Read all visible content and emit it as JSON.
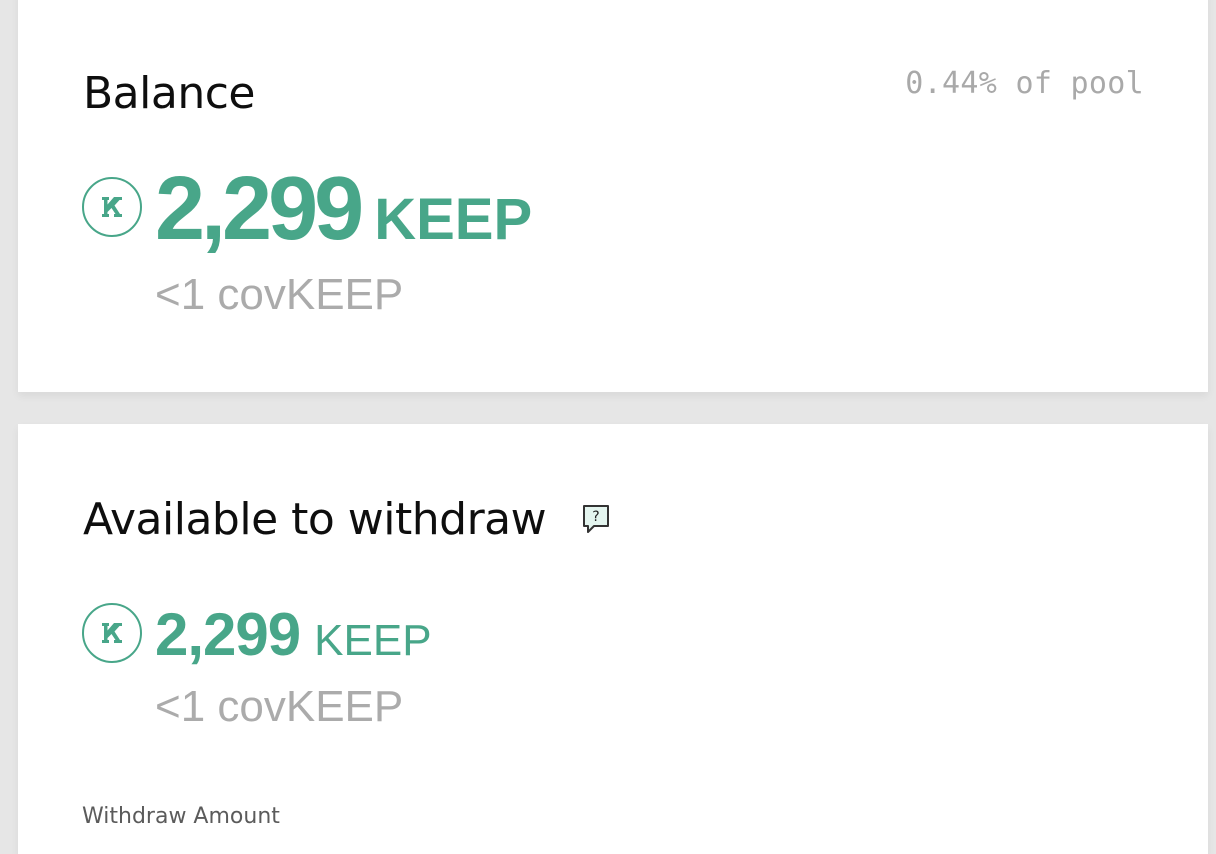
{
  "balance": {
    "title": "Balance",
    "pool_share": "0.44% of pool",
    "amount": "2,299",
    "unit": "KEEP",
    "cov_amount": "<1 covKEEP",
    "icon": "keep-token-icon"
  },
  "withdraw": {
    "title": "Available to withdraw",
    "help_icon": "question-chat-icon",
    "amount": "2,299",
    "unit": "KEEP",
    "cov_amount": "<1 covKEEP",
    "field_label": "Withdraw Amount"
  },
  "colors": {
    "accent": "#48a689",
    "muted": "#ababab",
    "background": "#e6e6e6",
    "card": "#ffffff"
  }
}
